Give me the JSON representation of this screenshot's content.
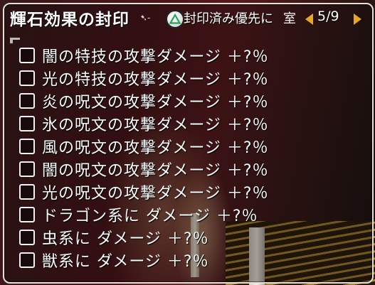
{
  "window": {
    "title": "輝石効果の封印",
    "priority_button_label": "封印済み優先に",
    "sort_truncated": "室",
    "page_indicator": "5/9"
  },
  "icons": {
    "triangle_button": "playstation-triangle-icon",
    "prev": "arrow-left-icon",
    "next": "arrow-right-icon"
  },
  "colors": {
    "arrow": "#e7a52a",
    "frame": "#e6e2da"
  },
  "effects": [
    {
      "label": "闇の特技の攻撃ダメージ ＋?％",
      "checked": false
    },
    {
      "label": "光の特技の攻撃ダメージ ＋?％",
      "checked": false
    },
    {
      "label": "炎の呪文の攻撃ダメージ ＋?％",
      "checked": false
    },
    {
      "label": "氷の呪文の攻撃ダメージ ＋?％",
      "checked": false
    },
    {
      "label": "風の呪文の攻撃ダメージ ＋?％",
      "checked": false
    },
    {
      "label": "闇の呪文の攻撃ダメージ ＋?％",
      "checked": false
    },
    {
      "label": "光の呪文の攻撃ダメージ ＋?％",
      "checked": false
    },
    {
      "label": "ドラゴン系に ダメージ ＋?％",
      "checked": false
    },
    {
      "label": "虫系に ダメージ ＋?％",
      "checked": false
    },
    {
      "label": "獣系に ダメージ ＋?％",
      "checked": false
    }
  ]
}
